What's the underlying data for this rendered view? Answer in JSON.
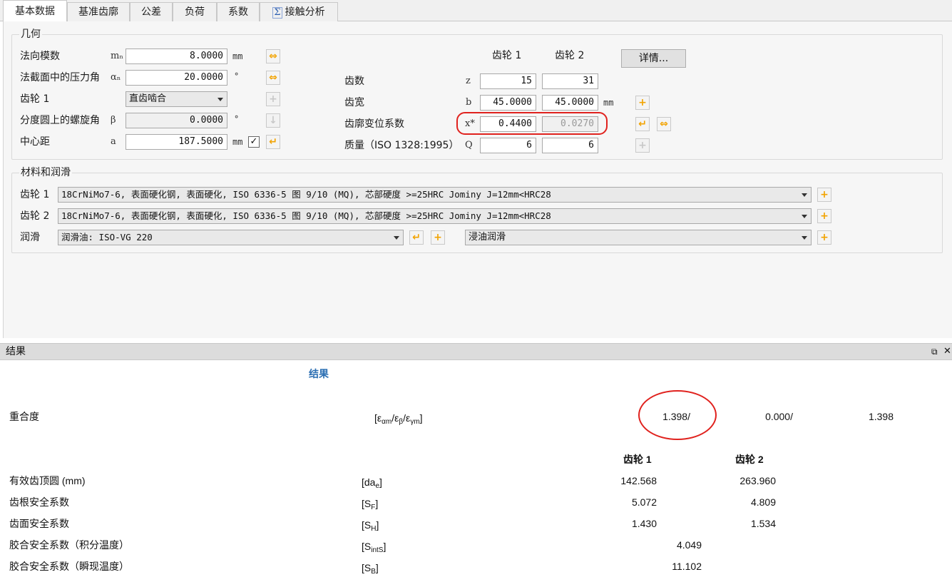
{
  "tabs": [
    {
      "label": "基本数据"
    },
    {
      "label": "基准齿廓"
    },
    {
      "label": "公差"
    },
    {
      "label": "负荷"
    },
    {
      "label": "系数"
    },
    {
      "label": "接触分析"
    }
  ],
  "geometry": {
    "title": "几何",
    "normal_module": {
      "label": "法向模数",
      "symbol": "mₙ",
      "value": "8.0000",
      "unit": "mm"
    },
    "pressure_angle": {
      "label": "法截面中的压力角",
      "symbol": "αₙ",
      "value": "20.0000",
      "unit": "°"
    },
    "gear1_type": {
      "label": "齿轮 1",
      "value": "直齿啮合"
    },
    "helix_angle": {
      "label": "分度圆上的螺旋角",
      "symbol": "β",
      "value": "0.0000",
      "unit": "°"
    },
    "center_distance": {
      "label": "中心距",
      "symbol": "a",
      "value": "187.5000",
      "unit": "mm",
      "check": "✓"
    },
    "col_gear1": "齿轮 1",
    "col_gear2": "齿轮 2",
    "details_button": "详情...",
    "teeth": {
      "label": "齿数",
      "symbol": "z",
      "gear1": "15",
      "gear2": "31"
    },
    "face_width": {
      "label": "齿宽",
      "symbol": "b",
      "gear1": "45.0000",
      "gear2": "45.0000",
      "unit": "mm"
    },
    "profile_shift": {
      "label": "齿廓变位系数",
      "symbol": "x*",
      "gear1": "0.4400",
      "gear2": "0.0270"
    },
    "quality": {
      "label": "质量（ISO 1328:1995）",
      "symbol": "Q",
      "gear1": "6",
      "gear2": "6"
    }
  },
  "materials": {
    "title": "材料和润滑",
    "gear1": {
      "label": "齿轮 1",
      "value": "18CrNiMo7-6, 表面硬化钢, 表面硬化, ISO 6336-5 图 9/10 (MQ), 芯部硬度 >=25HRC Jominy J=12mm<HRC28"
    },
    "gear2": {
      "label": "齿轮 2",
      "value": "18CrNiMo7-6, 表面硬化钢, 表面硬化, ISO 6336-5 图 9/10 (MQ), 芯部硬度 >=25HRC Jominy J=12mm<HRC28"
    },
    "lubrication": {
      "label": "润滑",
      "oil": "润滑油: ISO-VG 220",
      "method": "浸油润滑"
    }
  },
  "results_panel": {
    "title": "结果",
    "heading": "结果",
    "contact_ratio": {
      "label": "重合度",
      "sym_main": "[ε",
      "sub1": "αm",
      "mid1": "/ε",
      "sub2": "β",
      "mid2": "/ε",
      "sub3": "γm",
      "end": "]",
      "v1": "1.398/",
      "v2": "0.000/",
      "v3": "1.398"
    },
    "col_gear1": "齿轮 1",
    "col_gear2": "齿轮 2",
    "rows": [
      {
        "label": "有效齿顶圆 (mm)",
        "sym": "[da",
        "sub": "e",
        "end": "]",
        "gear1": "142.568",
        "gear2": "263.960"
      },
      {
        "label": "齿根安全系数",
        "sym": "[S",
        "sub": "F",
        "end": "]",
        "gear1": "5.072",
        "gear2": "4.809"
      },
      {
        "label": "齿面安全系数",
        "sym": "[S",
        "sub": "H",
        "end": "]",
        "gear1": "1.430",
        "gear2": "1.534"
      }
    ],
    "rows_single": [
      {
        "label": "胶合安全系数（积分温度）",
        "sym": "[S",
        "sub": "intS",
        "end": "]",
        "value": "4.049"
      },
      {
        "label": "胶合安全系数（瞬现温度）",
        "sym": "[S",
        "sub": "B",
        "end": "]",
        "value": "11.102"
      }
    ]
  },
  "colors": {
    "accent_yellow": "#f2a300",
    "highlight_red": "#e0221e",
    "heading_blue": "#2c6fb3"
  }
}
